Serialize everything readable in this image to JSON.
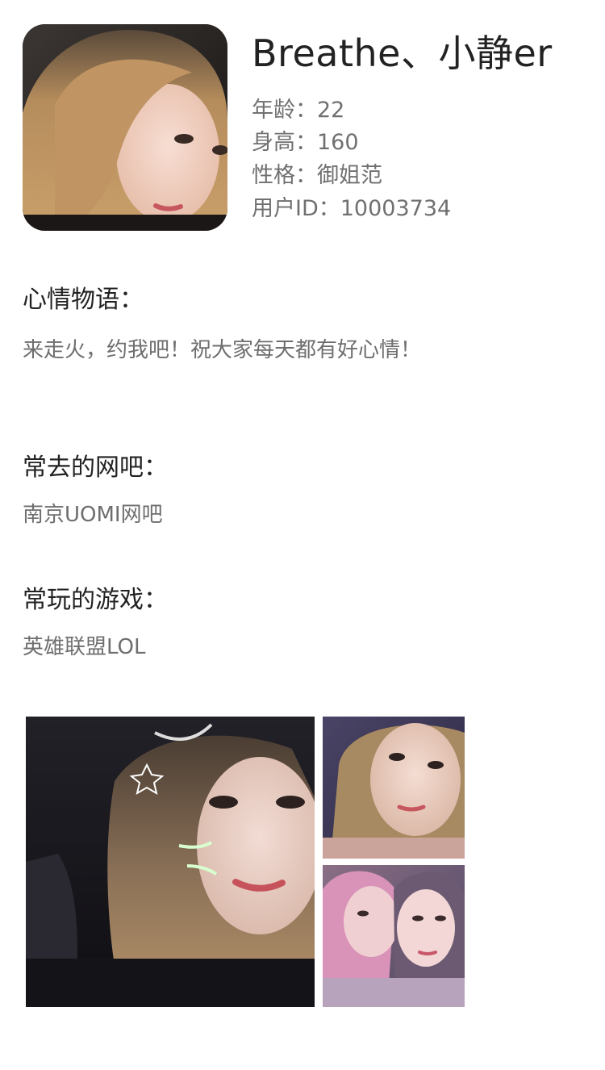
{
  "profile": {
    "name": "Breathe、小静er",
    "age": "年龄：22",
    "height": "身高：160",
    "personality": "性格：御姐范",
    "user_id": "用户ID：10003734"
  },
  "mood": {
    "title": "心情物语：",
    "text": "来走火，约我吧！祝大家每天都有好心情！"
  },
  "cafe": {
    "title": "常去的网吧：",
    "text": "南京UOMI网吧"
  },
  "game": {
    "title": "常玩的游戏：",
    "text": "英雄联盟LOL"
  },
  "gallery": {
    "photos": [
      "photo-selfie-large",
      "photo-selfie-small",
      "photo-duo"
    ]
  }
}
